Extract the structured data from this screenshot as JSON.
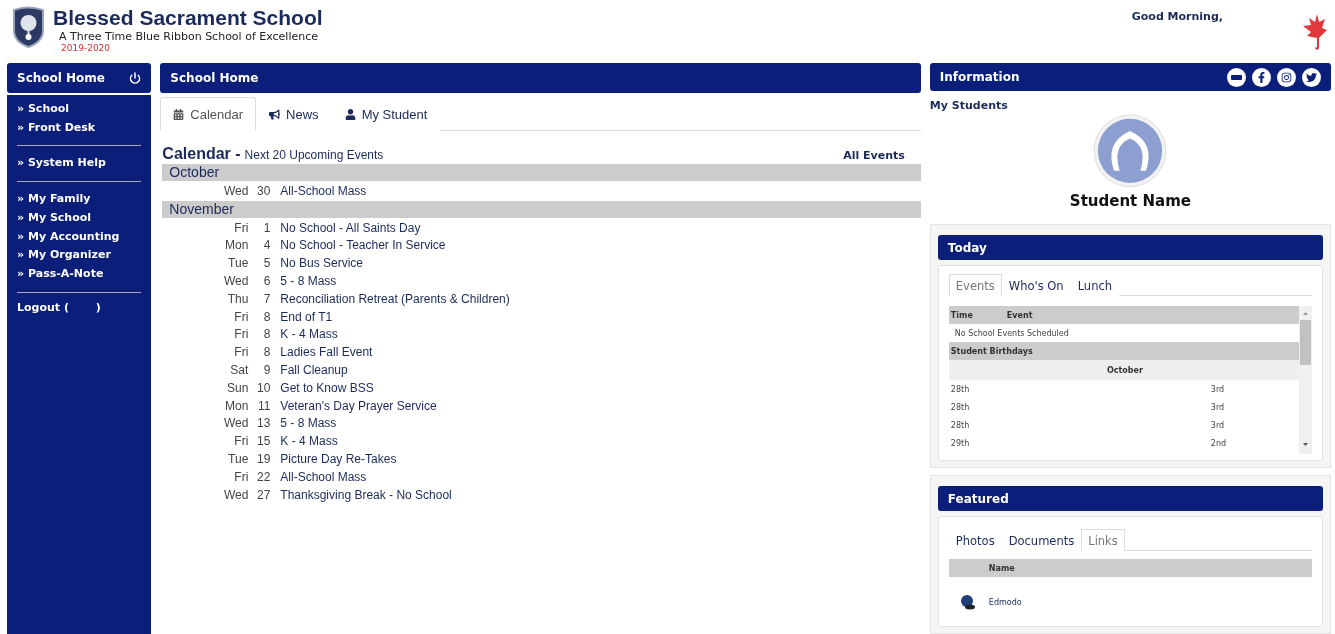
{
  "header": {
    "title": "Blessed Sacrament School",
    "subtitle": "A Three Time Blue Ribbon School of Excellence",
    "year": "2019-2020",
    "greeting": "Good Morning,"
  },
  "sidebar": {
    "title": "School Home",
    "groups": [
      {
        "items": [
          "» School",
          "» Front Desk"
        ]
      },
      {
        "items": [
          "» System Help"
        ]
      },
      {
        "items": [
          "» My Family",
          "» My School",
          "» My Accounting",
          "» My Organizer",
          "» Pass-A-Note"
        ]
      }
    ],
    "logout": "Logout (       )"
  },
  "main": {
    "title": "School Home",
    "tabs": [
      {
        "label": "Calendar",
        "kind": "calendar",
        "selected": true
      },
      {
        "label": "News",
        "kind": "news",
        "selected": false
      },
      {
        "label": "My Student",
        "kind": "student",
        "selected": false
      }
    ],
    "calendar": {
      "title": "Calendar -",
      "subtitle": "Next 20 Upcoming Events",
      "all_link": "All Events",
      "months": [
        {
          "name": "October",
          "events": [
            {
              "day": "Wed",
              "date": "30",
              "title": "All-School Mass"
            }
          ]
        },
        {
          "name": "November",
          "events": [
            {
              "day": "Fri",
              "date": "1",
              "title": "No School - All Saints Day"
            },
            {
              "day": "Mon",
              "date": "4",
              "title": "No School - Teacher In Service"
            },
            {
              "day": "Tue",
              "date": "5",
              "title": "No Bus Service"
            },
            {
              "day": "Wed",
              "date": "6",
              "title": "5 - 8 Mass"
            },
            {
              "day": "Thu",
              "date": "7",
              "title": "Reconciliation Retreat (Parents & Children)"
            },
            {
              "day": "Fri",
              "date": "8",
              "title": "End of T1"
            },
            {
              "day": "Fri",
              "date": "8",
              "title": "K - 4 Mass"
            },
            {
              "day": "Fri",
              "date": "8",
              "title": "Ladies Fall Event"
            },
            {
              "day": "Sat",
              "date": "9",
              "title": "Fall Cleanup"
            },
            {
              "day": "Sun",
              "date": "10",
              "title": "Get to Know BSS"
            },
            {
              "day": "Mon",
              "date": "11",
              "title": "Veteran's Day Prayer Service"
            },
            {
              "day": "Wed",
              "date": "13",
              "title": "5 - 8 Mass"
            },
            {
              "day": "Fri",
              "date": "15",
              "title": "K - 4 Mass"
            },
            {
              "day": "Tue",
              "date": "19",
              "title": "Picture Day Re-Takes"
            },
            {
              "day": "Fri",
              "date": "22",
              "title": "All-School Mass"
            },
            {
              "day": "Wed",
              "date": "27",
              "title": "Thanksgiving Break - No School"
            }
          ]
        }
      ]
    }
  },
  "info": {
    "title": "Information",
    "my_students": "My Students",
    "student_name": "Student Name",
    "today": {
      "title": "Today",
      "tabs": [
        {
          "label": "Events",
          "selected": true
        },
        {
          "label": "Who's On",
          "selected": false
        },
        {
          "label": "Lunch",
          "selected": false
        }
      ],
      "columns": [
        "Time",
        "Event"
      ],
      "empty": "No School Events Scheduled",
      "birthdays_title": "Student Birthdays",
      "birthday_month": "October",
      "birthdays": [
        {
          "date": "28th",
          "grade": "3rd"
        },
        {
          "date": "28th",
          "grade": "3rd"
        },
        {
          "date": "28th",
          "grade": "3rd"
        },
        {
          "date": "29th",
          "grade": "2nd"
        }
      ]
    },
    "featured": {
      "title": "Featured",
      "tabs": [
        {
          "label": "Photos",
          "selected": false
        },
        {
          "label": "Documents",
          "selected": false
        },
        {
          "label": "Links",
          "selected": true
        }
      ],
      "column": "Name",
      "links": [
        "Edmodo"
      ]
    }
  }
}
